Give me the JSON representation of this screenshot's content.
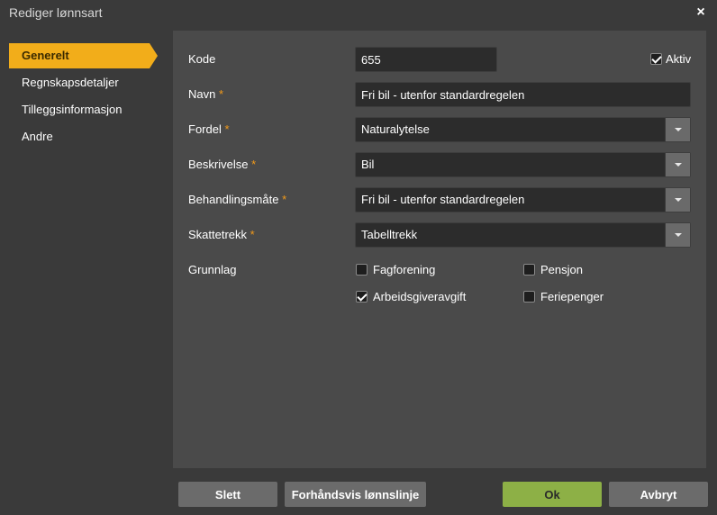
{
  "window": {
    "title": "Rediger lønnsart",
    "close_icon": "×"
  },
  "sidebar": {
    "items": [
      {
        "label": "Generelt",
        "active": true
      },
      {
        "label": "Regnskapsdetaljer",
        "active": false
      },
      {
        "label": "Tilleggsinformasjon",
        "active": false
      },
      {
        "label": "Andre",
        "active": false
      }
    ]
  },
  "form": {
    "kode": {
      "label": "Kode",
      "value": "655"
    },
    "aktiv": {
      "label": "Aktiv",
      "checked": true
    },
    "navn": {
      "label": "Navn",
      "required": "*",
      "value": "Fri bil - utenfor standardregelen"
    },
    "fordel": {
      "label": "Fordel",
      "required": "*",
      "value": "Naturalytelse"
    },
    "beskrivelse": {
      "label": "Beskrivelse",
      "required": "*",
      "value": "Bil"
    },
    "behandlingsmate": {
      "label": "Behandlingsmåte",
      "required": "*",
      "value": "Fri bil - utenfor standardregelen"
    },
    "skattetrekk": {
      "label": "Skattetrekk",
      "required": "*",
      "value": "Tabelltrekk"
    },
    "grunnlag": {
      "label": "Grunnlag",
      "options": [
        {
          "label": "Fagforening",
          "checked": false
        },
        {
          "label": "Pensjon",
          "checked": false
        },
        {
          "label": "Arbeidsgiveravgift",
          "checked": true
        },
        {
          "label": "Feriepenger",
          "checked": false
        }
      ]
    }
  },
  "footer": {
    "slett": "Slett",
    "forhandsvis": "Forhåndsvis lønnslinje",
    "ok": "Ok",
    "avbryt": "Avbryt"
  },
  "colors": {
    "accent": "#f2ad1a",
    "required": "#f29a1a",
    "ok_button": "#8db046",
    "panel": "#4a4a4a",
    "background": "#3a3a3a"
  }
}
